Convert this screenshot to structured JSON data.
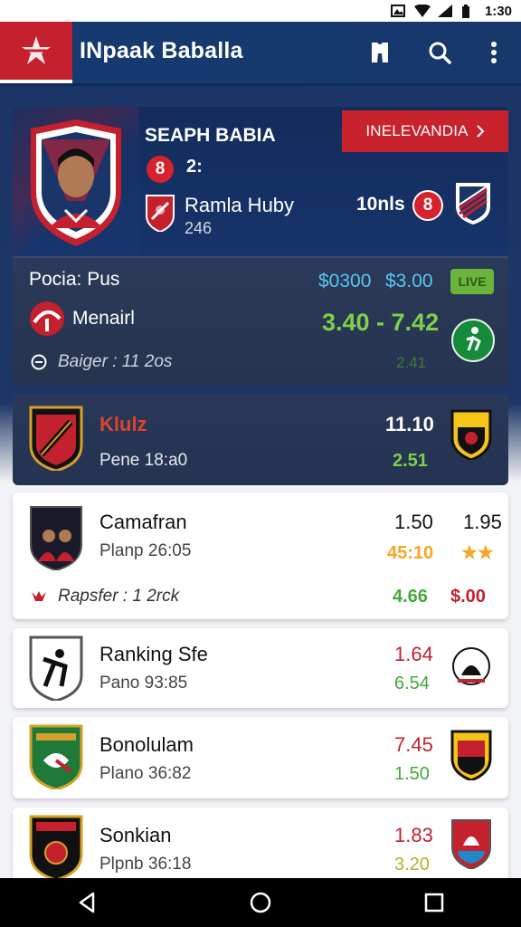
{
  "status": {
    "time": "1:30"
  },
  "appbar": {
    "title": "INpaak Baballa",
    "accent": "#c4202e",
    "actions": [
      "jersey-icon",
      "search-icon",
      "more-icon"
    ]
  },
  "hero": {
    "player_name": "SEAPH BABIA",
    "number": "8",
    "number2": "2:",
    "team": "Ramla Huby",
    "year": "246",
    "button_label": "INELEVANDIA",
    "stat_label": "10nls",
    "stat_number": "8"
  },
  "odds": {
    "title": "Pocia: Pus",
    "price1": "$0300",
    "price2": "$3.00",
    "pill": "LIVE",
    "label": "Menairl",
    "main": "3.40 - 7.42",
    "footer": "Baiger : 11 2os",
    "small": "2.41"
  },
  "matches": [
    {
      "team": "Klulz",
      "time": "Pene 18:a0",
      "o1": "11.10",
      "o2": "2.51",
      "style": "dark"
    },
    {
      "team": "Camafran",
      "time": "Planp 26:05",
      "o1": "1.50",
      "o1b": "1.95",
      "o2": "45:10",
      "o2b": "★★",
      "footer": "Rapsfer : 1 2rck",
      "f1": "4.66",
      "f2": "$.00",
      "style": "light"
    },
    {
      "team": "Ranking Sfe",
      "time": "Pano 93:85",
      "o1": "1.64",
      "o2": "6.54",
      "style": "light"
    },
    {
      "team": "Bonolulam",
      "time": "Plano 36:82",
      "o1": "7.45",
      "o2": "1.50",
      "style": "light"
    },
    {
      "team": "Sonkian",
      "time": "Plpnb 36:18",
      "o1": "1.83",
      "o2": "3.20",
      "style": "light"
    }
  ],
  "navbar": [
    "back-icon",
    "home-icon",
    "recents-icon"
  ],
  "colors": {
    "red": "#c8222d",
    "green": "#7ed04a",
    "blue": "#58c7ef",
    "gold": "#f5a623"
  }
}
